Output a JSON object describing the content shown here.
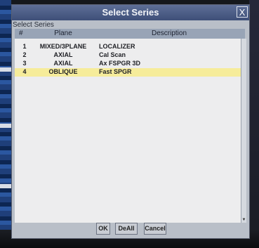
{
  "dialog": {
    "title": "Select Series",
    "close_label": "X",
    "group_label": "Select Series",
    "columns": {
      "number": "#",
      "plane": "Plane",
      "description": "Description"
    },
    "rows": [
      {
        "number": "1",
        "plane": "MIXED/3PLANE",
        "description": "LOCALIZER"
      },
      {
        "number": "2",
        "plane": "AXIAL",
        "description": "Cal Scan"
      },
      {
        "number": "3",
        "plane": "AXIAL",
        "description": "Ax FSPGR 3D"
      },
      {
        "number": "4",
        "plane": "OBLIQUE",
        "description": "Fast SPGR"
      }
    ],
    "selected_row": 4,
    "buttons": {
      "ok": "OK",
      "deselect_all": "DeAll",
      "cancel": "Cancel"
    }
  },
  "colors": {
    "title_bar": "#4a5b84",
    "selection": "#f6ec9a"
  }
}
